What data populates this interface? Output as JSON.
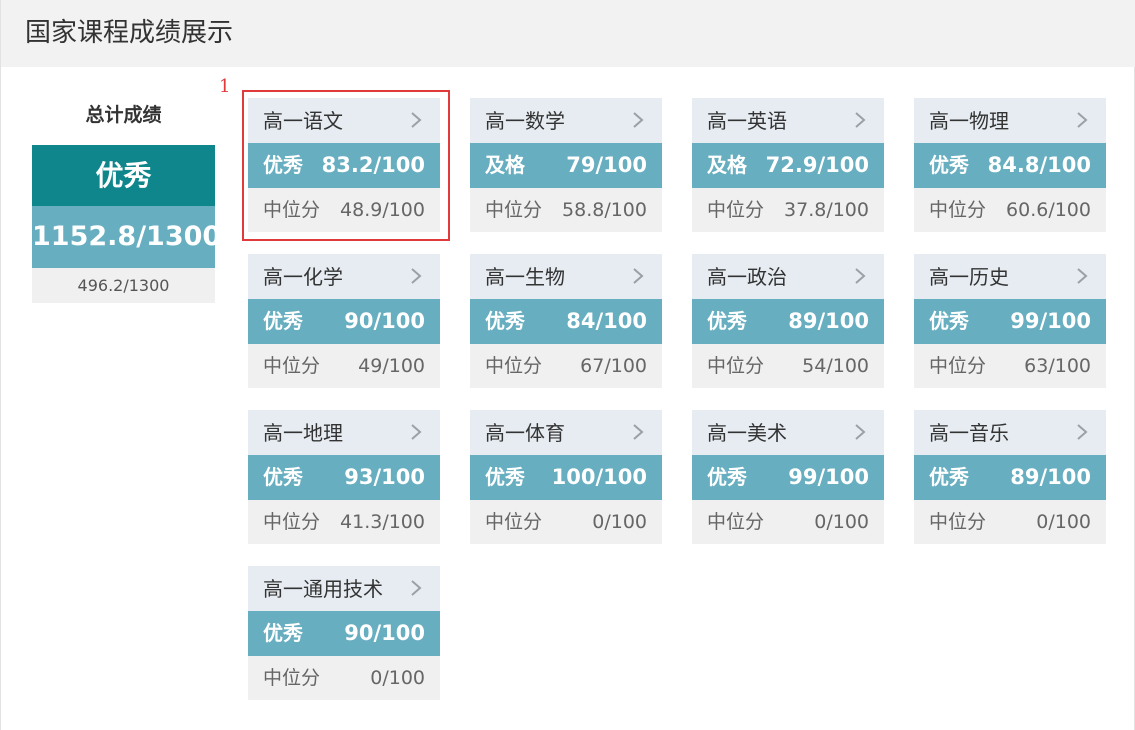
{
  "header": {
    "title": "国家课程成绩展示"
  },
  "total": {
    "label": "总计成绩",
    "grade": "优秀",
    "score": "1152.8/1300",
    "median": "496.2/1300"
  },
  "cards": [
    {
      "name": "高一语文",
      "grade": "优秀",
      "score": "83.2/100",
      "median_label": "中位分",
      "median": "48.9/100"
    },
    {
      "name": "高一数学",
      "grade": "及格",
      "score": "79/100",
      "median_label": "中位分",
      "median": "58.8/100"
    },
    {
      "name": "高一英语",
      "grade": "及格",
      "score": "72.9/100",
      "median_label": "中位分",
      "median": "37.8/100"
    },
    {
      "name": "高一物理",
      "grade": "优秀",
      "score": "84.8/100",
      "median_label": "中位分",
      "median": "60.6/100"
    },
    {
      "name": "高一化学",
      "grade": "优秀",
      "score": "90/100",
      "median_label": "中位分",
      "median": "49/100"
    },
    {
      "name": "高一生物",
      "grade": "优秀",
      "score": "84/100",
      "median_label": "中位分",
      "median": "67/100"
    },
    {
      "name": "高一政治",
      "grade": "优秀",
      "score": "89/100",
      "median_label": "中位分",
      "median": "54/100"
    },
    {
      "name": "高一历史",
      "grade": "优秀",
      "score": "99/100",
      "median_label": "中位分",
      "median": "63/100"
    },
    {
      "name": "高一地理",
      "grade": "优秀",
      "score": "93/100",
      "median_label": "中位分",
      "median": "41.3/100"
    },
    {
      "name": "高一体育",
      "grade": "优秀",
      "score": "100/100",
      "median_label": "中位分",
      "median": "0/100"
    },
    {
      "name": "高一美术",
      "grade": "优秀",
      "score": "99/100",
      "median_label": "中位分",
      "median": "0/100"
    },
    {
      "name": "高一音乐",
      "grade": "优秀",
      "score": "89/100",
      "median_label": "中位分",
      "median": "0/100"
    },
    {
      "name": "高一通用技术",
      "grade": "优秀",
      "score": "90/100",
      "median_label": "中位分",
      "median": "0/100"
    }
  ],
  "annotation": {
    "marker": "1"
  },
  "icons": {
    "card_link": "chevron-right-icon"
  },
  "colors": {
    "total_grade_bg": "#0e868b",
    "score_bar_bg": "#66aec0",
    "card_header_bg": "#e6ecf2",
    "median_bg": "#f0f0f0",
    "highlight": "#e03a3a"
  }
}
